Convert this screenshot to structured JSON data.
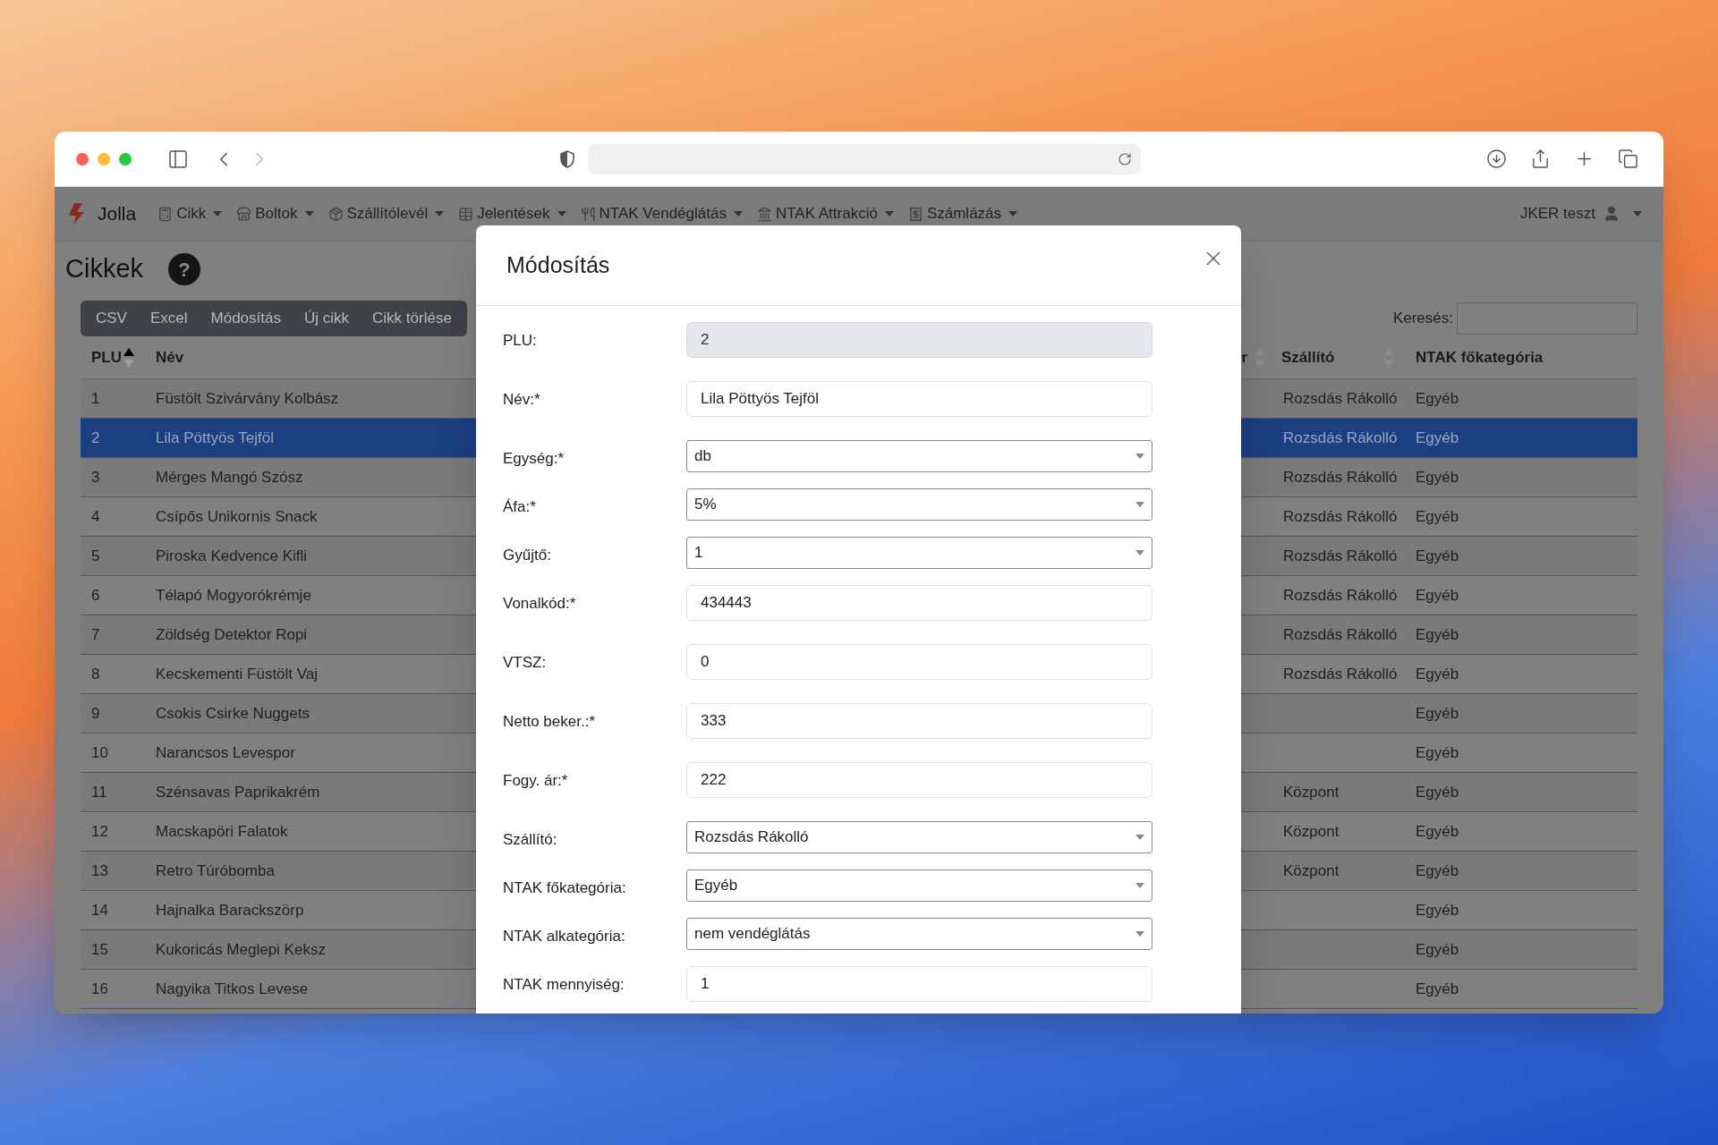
{
  "navbar": {
    "brand": "Jolla",
    "menus": [
      {
        "label": "Cikk"
      },
      {
        "label": "Boltok"
      },
      {
        "label": "Szállítólevél"
      },
      {
        "label": "Jelentések"
      },
      {
        "label": "NTAK Vendéglátás"
      },
      {
        "label": "NTAK Attrakció"
      },
      {
        "label": "Számlázás"
      }
    ],
    "user": "JKER teszt"
  },
  "page": {
    "title": "Cikkek",
    "help": "?"
  },
  "toolbar": {
    "buttons": [
      "CSV",
      "Excel",
      "Módosítás",
      "Új cikk",
      "Cikk törlése"
    ],
    "search_label": "Keresés:"
  },
  "table": {
    "columns": [
      {
        "label": "PLU",
        "sorted_ascending": true
      },
      {
        "label": "Név"
      },
      {
        "label": "r",
        "sorted_ascending": false
      },
      {
        "label": "Szállító",
        "sorted_ascending": false
      },
      {
        "label": "NTAK főkategória"
      }
    ],
    "rows": [
      {
        "plu": "1",
        "name": "Füstölt Szivárvány Kolbász",
        "supplier": "Rozsdás Rákolló",
        "category": "Egyéb",
        "selected": false
      },
      {
        "plu": "2",
        "name": "Lila Pöttyös Tejföl",
        "supplier": "Rozsdás Rákolló",
        "category": "Egyéb",
        "selected": true
      },
      {
        "plu": "3",
        "name": "Mérges Mangó Szósz",
        "supplier": "Rozsdás Rákolló",
        "category": "Egyéb",
        "selected": false
      },
      {
        "plu": "4",
        "name": "Csípős Unikornis Snack",
        "supplier": "Rozsdás Rákolló",
        "category": "Egyéb",
        "selected": false
      },
      {
        "plu": "5",
        "name": "Piroska Kedvence Kifli",
        "supplier": "Rozsdás Rákolló",
        "category": "Egyéb",
        "selected": false
      },
      {
        "plu": "6",
        "name": "Télapó Mogyorókrémje",
        "supplier": "Rozsdás Rákolló",
        "category": "Egyéb",
        "selected": false
      },
      {
        "plu": "7",
        "name": "Zöldség Detektor Ropi",
        "supplier": "Rozsdás Rákolló",
        "category": "Egyéb",
        "selected": false
      },
      {
        "plu": "8",
        "name": "Kecskementi Füstölt Vaj",
        "supplier": "Rozsdás Rákolló",
        "category": "Egyéb",
        "selected": false
      },
      {
        "plu": "9",
        "name": "Csokis Csirke Nuggets",
        "category": "Egyéb",
        "selected": false
      },
      {
        "plu": "10",
        "name": "Narancsos Levespor",
        "category": "Egyéb",
        "selected": false
      },
      {
        "plu": "11",
        "name": "Szénsavas Paprikakrém",
        "supplier": "Központ",
        "category": "Egyéb",
        "selected": false
      },
      {
        "plu": "12",
        "name": "Macskapöri Falatok",
        "supplier": "Központ",
        "category": "Egyéb",
        "selected": false
      },
      {
        "plu": "13",
        "name": "Retro Túróbomba",
        "supplier": "Központ",
        "category": "Egyéb",
        "selected": false
      },
      {
        "plu": "14",
        "name": "Hajnalka Barackszörp",
        "category": "Egyéb",
        "selected": false
      },
      {
        "plu": "15",
        "name": "Kukoricás Meglepi Keksz",
        "category": "Egyéb",
        "selected": false
      },
      {
        "plu": "16",
        "name": "Nagyika Titkos Levese",
        "category": "Egyéb",
        "selected": false
      }
    ]
  },
  "modal": {
    "title": "Módosítás",
    "fields": [
      {
        "label": "PLU:",
        "kind": "text",
        "value": "2",
        "disabled": true
      },
      {
        "label": "Név:*",
        "kind": "text",
        "value": "Lila Pöttyös Tejföl",
        "disabled": false
      },
      {
        "label": "Egység:*",
        "kind": "select",
        "value": "db"
      },
      {
        "label": "Áfa:*",
        "kind": "select",
        "value": "5%"
      },
      {
        "label": "Gyűjtő:",
        "kind": "select",
        "value": "1"
      },
      {
        "label": "Vonalkód:*",
        "kind": "text",
        "value": "434443",
        "disabled": false
      },
      {
        "label": "VTSZ:",
        "kind": "text",
        "value": "0",
        "disabled": false
      },
      {
        "label": "Netto beker.:*",
        "kind": "text",
        "value": "333",
        "disabled": false
      },
      {
        "label": "Fogy. ár:*",
        "kind": "text",
        "value": "222",
        "disabled": false
      },
      {
        "label": "Szállító:",
        "kind": "select",
        "value": "Rozsdás Rákolló"
      },
      {
        "label": "NTAK főkategória:",
        "kind": "select",
        "value": "Egyéb"
      },
      {
        "label": "NTAK alkategória:",
        "kind": "select",
        "value": "nem vendéglátás"
      },
      {
        "label": "NTAK mennyiség:",
        "kind": "text",
        "value": "1",
        "disabled": false
      }
    ]
  }
}
